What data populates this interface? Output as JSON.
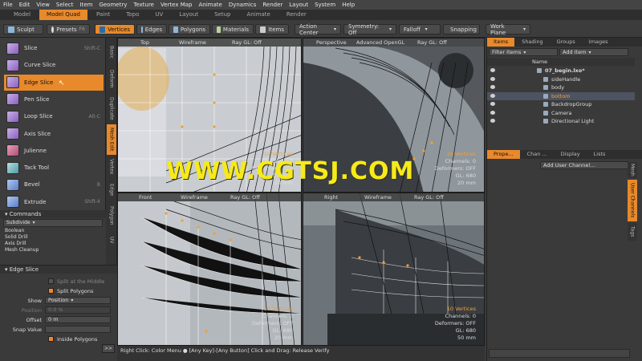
{
  "menu": [
    "File",
    "Edit",
    "View",
    "Select",
    "Item",
    "Geometry",
    "Texture",
    "Vertex Map",
    "Animate",
    "Dynamics",
    "Render",
    "Layout",
    "System",
    "Help"
  ],
  "layout_tabs": [
    {
      "label": "Model",
      "active": false
    },
    {
      "label": "Model Quad",
      "active": true
    },
    {
      "label": "Paint",
      "active": false
    },
    {
      "label": "Topo",
      "active": false
    },
    {
      "label": "UV",
      "active": false
    },
    {
      "label": "Layout",
      "active": false
    },
    {
      "label": "Setup",
      "active": false
    },
    {
      "label": "Animate",
      "active": false
    },
    {
      "label": "Render",
      "active": false
    }
  ],
  "toolbar": {
    "sculpt": "Sculpt",
    "presets": "Presets",
    "presets_key": "F6",
    "vertices": "Vertices",
    "edges": "Edges",
    "polygons": "Polygons",
    "materials": "Materials",
    "items": "Items",
    "action_center": "Action Center",
    "symmetry": "Symmetry: Off",
    "falloff": "Falloff",
    "snapping": "Snapping",
    "work_plane": "Work Plane"
  },
  "tools": [
    {
      "label": "Slice",
      "shortcut": "Shift-C",
      "color": "purple",
      "active": false
    },
    {
      "label": "Curve Slice",
      "shortcut": "",
      "color": "purple",
      "active": false
    },
    {
      "label": "Edge Slice",
      "shortcut": "",
      "color": "purple",
      "active": true
    },
    {
      "label": "Pen Slice",
      "shortcut": "",
      "color": "purple",
      "active": false
    },
    {
      "label": "Loop Slice",
      "shortcut": "Alt-C",
      "color": "purple",
      "active": false
    },
    {
      "label": "Axis Slice",
      "shortcut": "",
      "color": "purple",
      "active": false
    },
    {
      "label": "Julienne",
      "shortcut": "",
      "color": "red",
      "active": false
    },
    {
      "label": "Tack Tool",
      "shortcut": "",
      "color": "teal",
      "active": false
    },
    {
      "label": "Bevel",
      "shortcut": "B",
      "color": "blue",
      "active": false
    },
    {
      "label": "Extrude",
      "shortcut": "Shift-X",
      "color": "blue",
      "active": false
    }
  ],
  "vertical_tabs": [
    {
      "label": "Basic",
      "active": false
    },
    {
      "label": "Deform",
      "active": false
    },
    {
      "label": "Duplicate",
      "active": false
    },
    {
      "label": "Mesh Edit",
      "active": true
    },
    {
      "label": "Vertex",
      "active": false
    },
    {
      "label": "Edge",
      "active": false
    },
    {
      "label": "Polygon",
      "active": false
    },
    {
      "label": "UV",
      "active": false
    }
  ],
  "commands": {
    "title": "Commands",
    "selected": "Subdivide",
    "items": [
      "Boolean",
      "Solid Drill",
      "Axis Drill",
      "Mesh Cleanup"
    ]
  },
  "edge_slice": {
    "title": "Edge Slice",
    "split_middle": "Split at the Middle",
    "split_polygons": "Split Polygons",
    "show_label": "Show",
    "show_value": "Position",
    "position_label": "Position",
    "position_value": "0.0 %",
    "offset_label": "Offset",
    "offset_value": "0 m",
    "snap_label": "Snap Value",
    "inside_polygons": "Inside Polygons",
    "expand": ">>"
  },
  "viewports": [
    {
      "view": "Top",
      "shade": "Wireframe",
      "ray": "Ray GL: Off",
      "vertices": "10 Vertices",
      "channels": "Channels: 0",
      "deformers": "Deformers: OFF",
      "gl": "GL: 680",
      "scale": "20 mm"
    },
    {
      "view": "Perspective",
      "shade": "Advanced OpenGL",
      "ray": "Ray GL: Off",
      "vertices": "10 Vertices",
      "channels": "Channels: 0",
      "deformers": "Deformers: OFF",
      "gl": "GL: 680",
      "scale": "20 mm"
    },
    {
      "view": "Front",
      "shade": "Wireframe",
      "ray": "Ray GL: Off",
      "vertices": "10 Vertices",
      "channels": "Channels: 0",
      "deformers": "Deformers: OFF",
      "gl": "GL: 680",
      "scale": "20 mm"
    },
    {
      "view": "Right",
      "shade": "Wireframe",
      "ray": "Ray GL: Off",
      "vertices": "10 Vertices",
      "channels": "Channels: 0",
      "deformers": "Deformers: OFF",
      "gl": "GL: 680",
      "scale": "50 mm"
    }
  ],
  "watermark": "WWW.CGTSJ.COM",
  "status_bar": "Right Click: Color Menu ● [Any Key]-[Any Button] Click and Drag: Release Verify",
  "right_tabs_top": [
    {
      "label": "Items",
      "active": true
    },
    {
      "label": "Shading",
      "active": false
    },
    {
      "label": "Groups",
      "active": false
    },
    {
      "label": "Images",
      "active": false
    }
  ],
  "filter_items": "Filter Items",
  "add_item": "Add Item",
  "name_column": "Name",
  "scene_items": [
    {
      "label": "07_begin.lxo*",
      "indent": 0,
      "selected": false
    },
    {
      "label": "sideHandle",
      "indent": 1,
      "selected": false
    },
    {
      "label": "body",
      "indent": 1,
      "selected": false
    },
    {
      "label": "bottom",
      "indent": 1,
      "selected": true
    },
    {
      "label": "BackdropGroup",
      "indent": 1,
      "selected": false
    },
    {
      "label": "Camera",
      "indent": 1,
      "selected": false
    },
    {
      "label": "Directional Light",
      "indent": 1,
      "selected": false
    }
  ],
  "right_tabs_bottom": [
    {
      "label": "Prope...",
      "active": true
    },
    {
      "label": "Chan ...",
      "active": false
    },
    {
      "label": "Display",
      "active": false
    },
    {
      "label": "Lists",
      "active": false
    }
  ],
  "add_user_channel": "Add User Channel...",
  "right_vertical_tabs": [
    {
      "label": "Mesh",
      "active": false
    },
    {
      "label": "User Channels",
      "active": true
    },
    {
      "label": "Tags",
      "active": false
    }
  ],
  "colors": {
    "accent": "#e8892b",
    "watermark": "#f6ea1a",
    "panel": "#3a3a3a"
  }
}
